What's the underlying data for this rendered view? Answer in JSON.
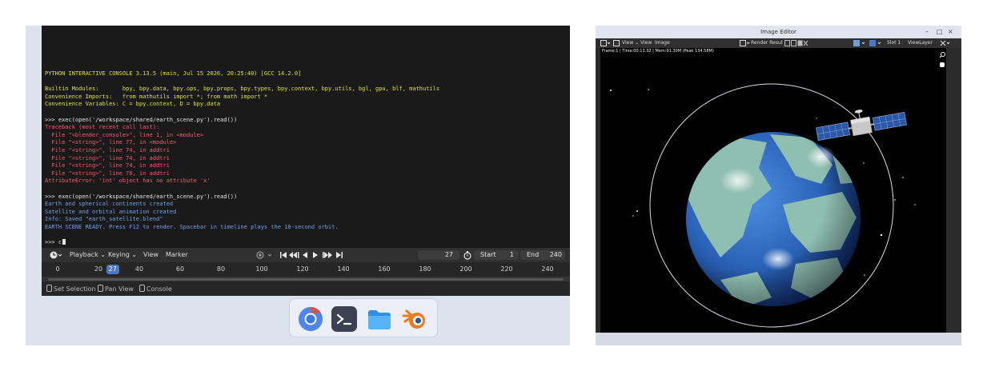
{
  "console": {
    "lines": [
      {
        "text": "PYTHON INTERACTIVE CONSOLE 3.13.5 (main, Jul 15 2026, 20:25:40) [GCC 14.2.0]",
        "kind": "out"
      },
      {
        "text": "",
        "kind": "blank"
      },
      {
        "text": "Builtin Modules:       bpy, bpy.data, bpy.ops, bpy.props, bpy.types, bpy.context, bpy.utils, bgl, gpu, blf, mathutils",
        "kind": "out"
      },
      {
        "text": "Convenience Imports:   from mathutils import *; from math import *",
        "kind": "out"
      },
      {
        "text": "Convenience Variables: C = bpy.context, D = bpy.data",
        "kind": "out"
      },
      {
        "text": "",
        "kind": "blank"
      },
      {
        "text": ">>> exec(open('/workspace/shared/earth_scene.py').read())",
        "kind": "cmd"
      },
      {
        "text": "Traceback (most recent call last):",
        "kind": "err"
      },
      {
        "text": "  File \"<blender_console>\", line 1, in <module>",
        "kind": "err"
      },
      {
        "text": "  File \"<string>\", line 77, in <module>",
        "kind": "err"
      },
      {
        "text": "  File \"<string>\", line 74, in addtri",
        "kind": "err"
      },
      {
        "text": "  File \"<string>\", line 74, in addtri",
        "kind": "err"
      },
      {
        "text": "  File \"<string>\", line 74, in addtri",
        "kind": "err"
      },
      {
        "text": "  File \"<string>\", line 76, in addtri",
        "kind": "err"
      },
      {
        "text": "AttributeError: 'int' object has no attribute 'x'",
        "kind": "err"
      },
      {
        "text": "",
        "kind": "blank"
      },
      {
        "text": ">>> exec(open('/workspace/shared/earth_scene.py').read())",
        "kind": "cmd"
      },
      {
        "text": "Earth and spherical continents created",
        "kind": "info"
      },
      {
        "text": "Satellite and orbital animation created",
        "kind": "info"
      },
      {
        "text": "Info: Saved \"earth_satellite.blend\"",
        "kind": "info"
      },
      {
        "text": "EARTH SCENE READY. Press F12 to render. Spacebar in timeline plays the 10-second orbit.",
        "kind": "info"
      },
      {
        "text": "",
        "kind": "blank"
      }
    ],
    "prompt": ">>> c"
  },
  "timeline": {
    "menus": [
      "Playback",
      "Keying",
      "View",
      "Marker"
    ],
    "current_frame": "27",
    "start_label": "Start",
    "start_value": "1",
    "end_label": "End",
    "end_value": "240",
    "ticks": [
      "0",
      "20",
      "40",
      "60",
      "80",
      "100",
      "120",
      "140",
      "160",
      "180",
      "200",
      "220",
      "240"
    ]
  },
  "statusbar": {
    "items": [
      "Set Selection",
      "Pan View",
      "Console"
    ]
  },
  "dock": {
    "apps": [
      "chrome-icon",
      "terminal-icon",
      "files-icon",
      "blender-icon"
    ]
  },
  "image_editor": {
    "window_title": "Image Editor",
    "menus": [
      "View",
      "View",
      "Image"
    ],
    "image_name": "Render Result",
    "slot": "Slot 1",
    "view_layer": "ViewLayer",
    "frame_info": "Frame:1 | Time:00:13.32 | Mem:91.30M (Peak 134.58M)"
  },
  "colors": {
    "console_output": "#e0e51f",
    "console_error": "#ff5a6a",
    "console_info": "#6fa2e8",
    "frame_badge": "#4c77c2"
  }
}
